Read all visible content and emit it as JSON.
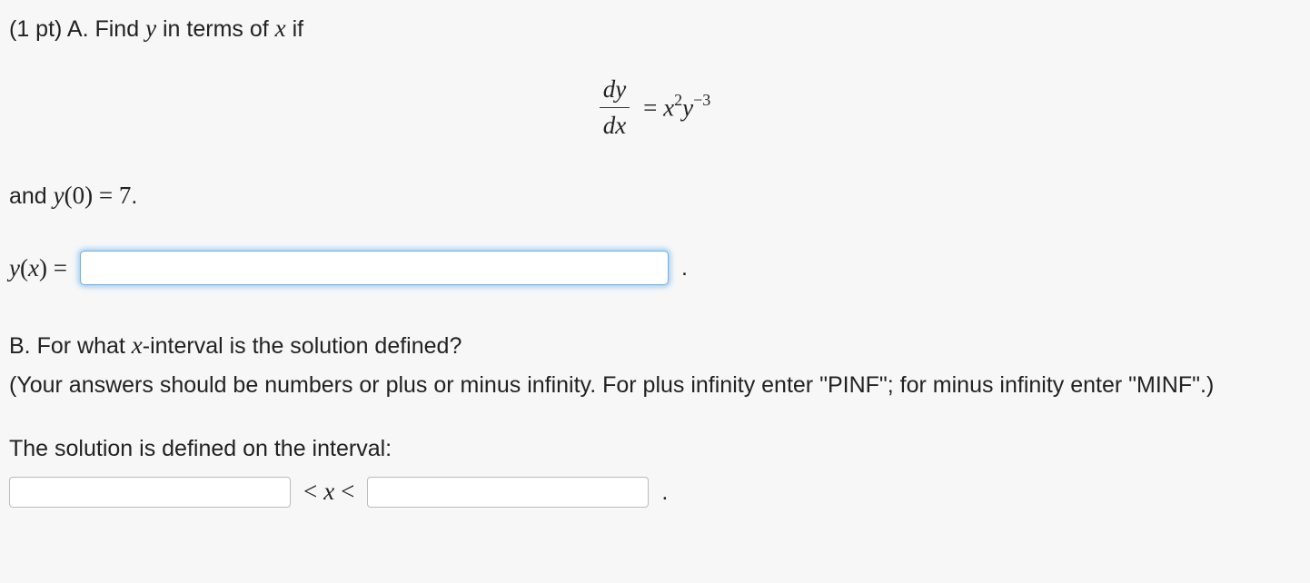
{
  "problem": {
    "intro_prefix": "(1 pt) A. Find ",
    "intro_var_y": "y",
    "intro_mid": " in terms of ",
    "intro_var_x": "x",
    "intro_suffix": " if",
    "equation": {
      "frac_num_d": "d",
      "frac_num_y": "y",
      "frac_den_d": "d",
      "frac_den_x": "x",
      "equals": " = ",
      "rhs_x": "x",
      "rhs_x_exp": "2",
      "rhs_y": "y",
      "rhs_y_exp": "−3"
    },
    "ic_prefix": "and ",
    "ic_y": "y",
    "ic_paren_open": "(",
    "ic_zero": "0",
    "ic_paren_close": ")",
    "ic_eq": " = ",
    "ic_val": "7",
    "ic_period": ".",
    "answer_label_y": "y",
    "answer_label_open": "(",
    "answer_label_x": "x",
    "answer_label_close": ")",
    "answer_label_eq": " = ",
    "answer_value": "",
    "answer_period": "."
  },
  "partB": {
    "question_prefix": "B. For what ",
    "question_x": "x",
    "question_suffix": "-interval is the solution defined?",
    "hint": "(Your answers should be numbers or plus or minus infinity. For plus infinity enter \"PINF\"; for minus infinity enter \"MINF\".)",
    "interval_label": "The solution is defined on the interval:",
    "lower_value": "",
    "lt1": "<",
    "x_var": "x",
    "lt2": "<",
    "upper_value": "",
    "period": "."
  }
}
